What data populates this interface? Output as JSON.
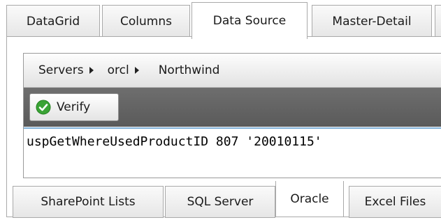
{
  "top_tabs": [
    {
      "label": "DataGrid"
    },
    {
      "label": "Columns"
    },
    {
      "label": "Data Source"
    },
    {
      "label": "Master-Detail"
    }
  ],
  "breadcrumb": [
    {
      "label": "Servers"
    },
    {
      "label": "orcl"
    },
    {
      "label": "Northwind"
    }
  ],
  "toolbar": {
    "verify_label": "Verify"
  },
  "query": {
    "text": "uspGetWhereUsedProductID 807 '20010115'"
  },
  "bottom_tabs": [
    {
      "label": "SharePoint Lists"
    },
    {
      "label": "SQL Server"
    },
    {
      "label": "Oracle"
    },
    {
      "label": "Excel Files"
    }
  ],
  "colors": {
    "verify_icon": "#3aa335",
    "accent_border": "#7fb0d8"
  }
}
